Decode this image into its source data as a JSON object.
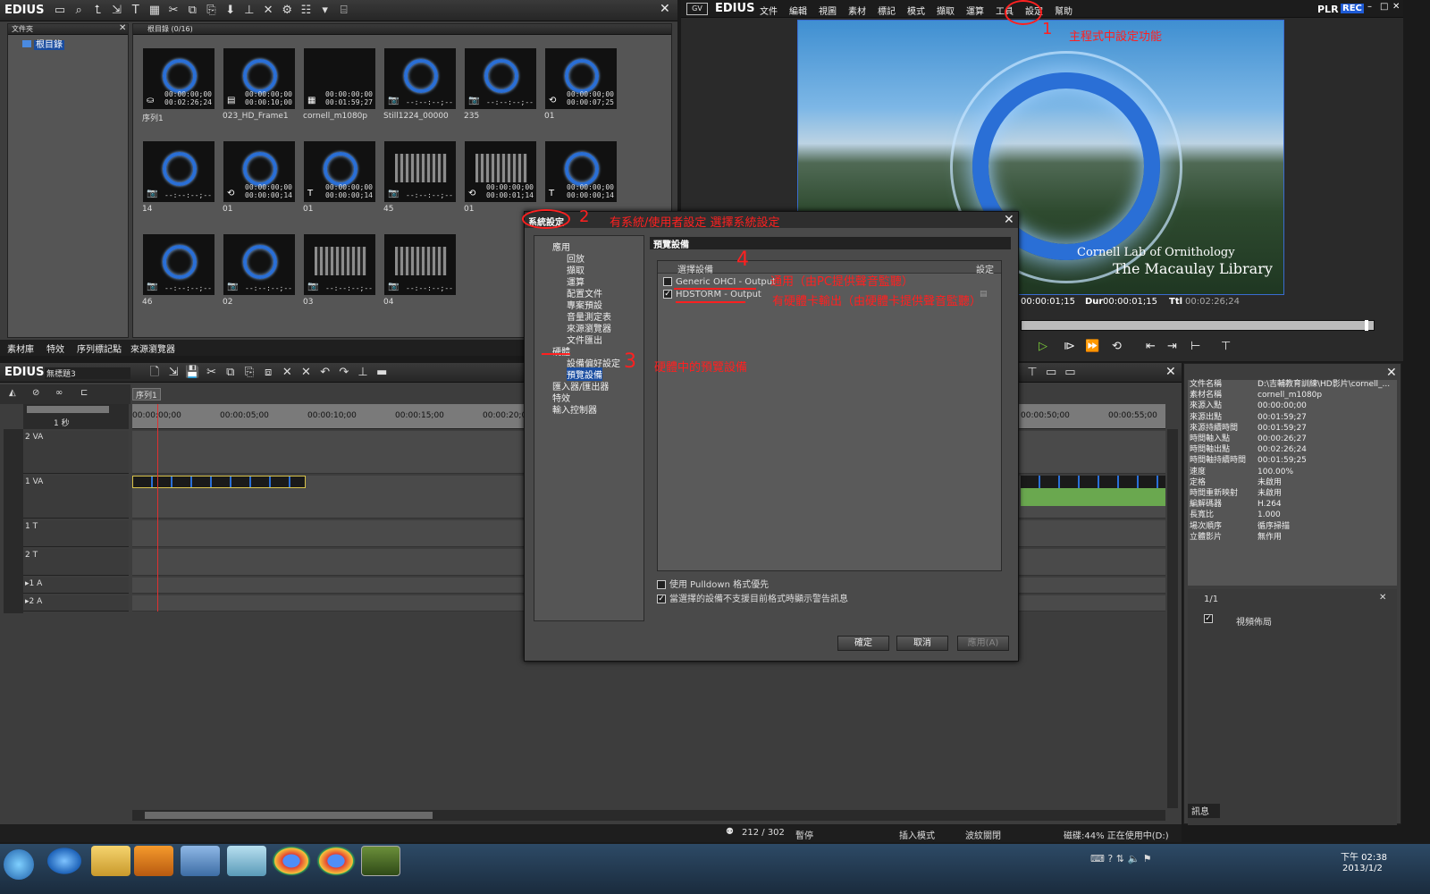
{
  "app": {
    "name": "EDIUS"
  },
  "colors": {
    "accent": "#2a6fd6",
    "annotation": "#ff2020",
    "rec": "#1e5bd6"
  },
  "folder_panel": {
    "title": "文件夾",
    "root_label": "根目錄"
  },
  "bin": {
    "header": "根目錄 (0/16)",
    "clips": [
      {
        "name": "序列1",
        "tc1": "00:00:00;00",
        "tc2": "00:02:26;24",
        "icon": "sequence-icon",
        "kind": "ring"
      },
      {
        "name": "023_HD_Frame1",
        "tc1": "00:00:00;00",
        "tc2": "00:00:10;00",
        "icon": "video-icon",
        "kind": "ring"
      },
      {
        "name": "cornell_m1080p",
        "tc1": "00:00:00;00",
        "tc2": "00:01:59;27",
        "icon": "film-icon",
        "kind": "black"
      },
      {
        "name": "Still1224_00000",
        "tc1": "--:--:--;--",
        "tc2": "",
        "icon": "camera-icon",
        "kind": "ring"
      },
      {
        "name": "235",
        "tc1": "--:--:--;--",
        "tc2": "",
        "icon": "camera-icon",
        "kind": "ring"
      },
      {
        "name": "01",
        "tc1": "00:00:00;00",
        "tc2": "00:00:07;25",
        "icon": "loop-icon",
        "kind": "ring"
      },
      {
        "name": "14",
        "tc1": "--:--:--;--",
        "tc2": "",
        "icon": "camera-icon",
        "kind": "ring"
      },
      {
        "name": "01",
        "tc1": "00:00:00;00",
        "tc2": "00:00:00;14",
        "icon": "loop-icon",
        "kind": "ring"
      },
      {
        "name": "01",
        "tc1": "00:00:00;00",
        "tc2": "00:00:00;14",
        "icon": "title-icon",
        "kind": "ring"
      },
      {
        "name": "45",
        "tc1": "--:--:--;--",
        "tc2": "",
        "icon": "camera-icon",
        "kind": "hourglass"
      },
      {
        "name": "01",
        "tc1": "00:00:00;00",
        "tc2": "00:00:01;14",
        "icon": "loop-icon",
        "kind": "hourglass"
      },
      {
        "name": "",
        "tc1": "00:00:00;00",
        "tc2": "00:00:00;14",
        "icon": "title-icon",
        "kind": "ring"
      },
      {
        "name": "46",
        "tc1": "--:--:--;--",
        "tc2": "",
        "icon": "camera-icon",
        "kind": "ring"
      },
      {
        "name": "02",
        "tc1": "--:--:--;--",
        "tc2": "",
        "icon": "camera-icon",
        "kind": "ring"
      },
      {
        "name": "03",
        "tc1": "--:--:--;--",
        "tc2": "",
        "icon": "camera-icon",
        "kind": "hourglass"
      },
      {
        "name": "04",
        "tc1": "--:--:--;--",
        "tc2": "",
        "icon": "camera-icon",
        "kind": "hourglass"
      }
    ],
    "tabs": [
      "素材庫",
      "特效",
      "序列標記點",
      "來源瀏覽器"
    ]
  },
  "player": {
    "menu": [
      "文件",
      "編輯",
      "視圖",
      "素材",
      "標記",
      "模式",
      "擷取",
      "運算",
      "工具",
      "設定",
      "幫助"
    ],
    "plr": "PLR",
    "rec": "REC",
    "overlay_line1": "Cornell Lab of Ornithology",
    "overlay_line2": "The Macaulay Library",
    "tc_cur": "00:00:01;15",
    "dur_label": "Dur",
    "dur": "00:00:01;15",
    "ttl_label": "Ttl",
    "ttl": "00:02:26;24"
  },
  "dialog": {
    "title": "系統設定",
    "tree": {
      "app": "應用",
      "app_children": [
        "回放",
        "擷取",
        "運算",
        "配置文件",
        "專案預設",
        "音量測定表",
        "來源瀏覽器",
        "文件匯出"
      ],
      "hardware": "硬體",
      "hw_children": [
        "設備偏好設定",
        "預覽設備"
      ],
      "others": [
        "匯入器/匯出器",
        "特效",
        "輸入控制器"
      ]
    },
    "section_title": "預覽設備",
    "col_device": "選擇設備",
    "col_setting": "設定",
    "devices": [
      {
        "label": "Generic OHCI - Output",
        "checked": false
      },
      {
        "label": "HDSTORM - Output",
        "checked": true
      }
    ],
    "opt1": "使用 Pulldown 格式優先",
    "opt2": "當選擇的設備不支援目前格式時顯示警告訊息",
    "ok": "確定",
    "cancel": "取消",
    "apply": "應用(A)"
  },
  "annotations": {
    "a1": "主程式中設定功能",
    "a2": "有系統/使用者設定 選擇系統設定",
    "a3": "硬體中的預覽設備",
    "a4a": "通用（由PC提供聲音監聽）",
    "a4b": "有硬體卡輸出（由硬體卡提供聲音監聽）",
    "n1": "1",
    "n2": "2",
    "n3": "3",
    "n4": "4"
  },
  "timeline": {
    "title": "無標題3",
    "seq_tab": "序列1",
    "scale": "1 秒",
    "ruler": [
      "00:00:00;00",
      "00:00:05;00",
      "00:00:10;00",
      "00:00:15;00",
      "00:00:20;0",
      "00:00:50;00",
      "00:00:55;00"
    ],
    "tracks": [
      "2 VA",
      "1 VA",
      "1 T",
      "2 T",
      "▸1 A",
      "▸2 A"
    ]
  },
  "properties": {
    "rows": [
      [
        "文件名稱",
        "D:\\吉輔教育訓練\\HD影片\\cornell_..."
      ],
      [
        "素材名稱",
        "cornell_m1080p"
      ],
      [
        "來源入點",
        "00:00:00;00"
      ],
      [
        "來源出點",
        "00:01:59;27"
      ],
      [
        "來源持續時間",
        "00:01:59;27"
      ],
      [
        "時間軸入點",
        "00:00:26;27"
      ],
      [
        "時間軸出點",
        "00:02:26;24"
      ],
      [
        "時間軸持續時間",
        "00:01:59;25"
      ],
      [
        "速度",
        "100.00%"
      ],
      [
        "定格",
        "未啟用"
      ],
      [
        "時間重新映射",
        "未啟用"
      ],
      [
        "編解碼器",
        "H.264"
      ],
      [
        "長寬比",
        "1.000"
      ],
      [
        "場次順序",
        "循序掃描"
      ],
      [
        "立體影片",
        "無作用"
      ]
    ],
    "page": "1/1",
    "effect": "視頻佈局",
    "info_tab": "訊息"
  },
  "status": {
    "frames": "212 / 302",
    "state": "暫停",
    "mode": "插入模式",
    "ripple": "波紋關閉",
    "disk": "磁碟:44% 正在使用中(D:)"
  },
  "taskbar": {
    "time": "下午 02:38",
    "date": "2013/1/2"
  }
}
